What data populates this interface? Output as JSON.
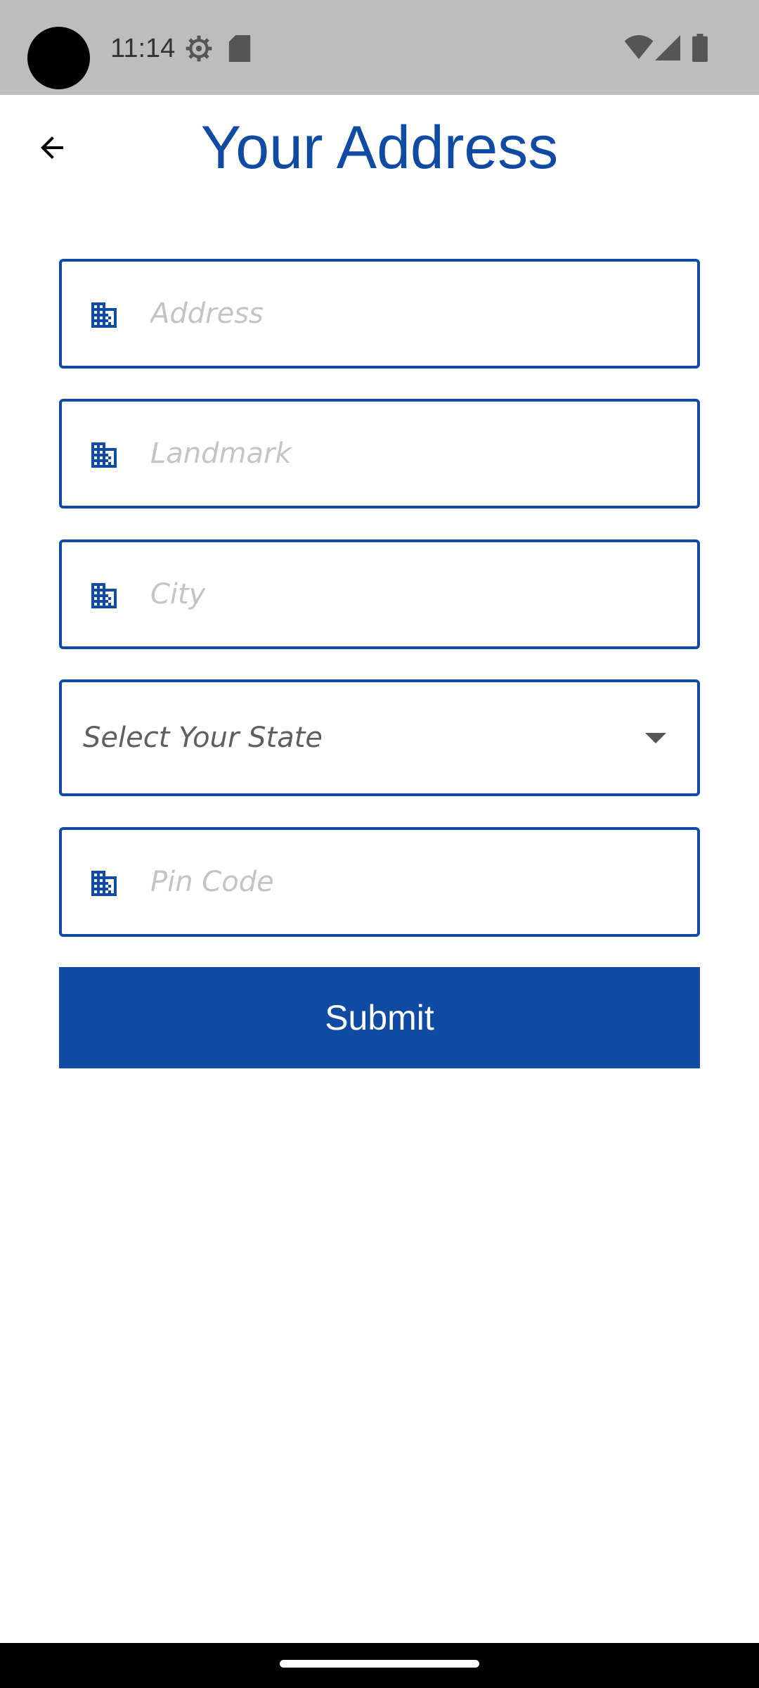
{
  "status_bar": {
    "time": "11:14",
    "icons": [
      "gear-icon",
      "sd-card-icon",
      "wifi-icon",
      "signal-icon",
      "battery-icon"
    ]
  },
  "header": {
    "title": "Your Address",
    "back_icon": "arrow-left-icon"
  },
  "form": {
    "address": {
      "placeholder": "Address",
      "value": "",
      "icon": "building-icon"
    },
    "landmark": {
      "placeholder": "Landmark",
      "value": "",
      "icon": "building-icon"
    },
    "city": {
      "placeholder": "City",
      "value": "",
      "icon": "building-icon"
    },
    "state": {
      "selected": "Select Your State"
    },
    "pin_code": {
      "placeholder": "Pin Code",
      "value": "",
      "icon": "building-icon"
    },
    "submit_label": "Submit"
  },
  "colors": {
    "accent": "#0f4aa3",
    "status_bar": "#bdbdbd",
    "placeholder": "#c4c4c4"
  }
}
